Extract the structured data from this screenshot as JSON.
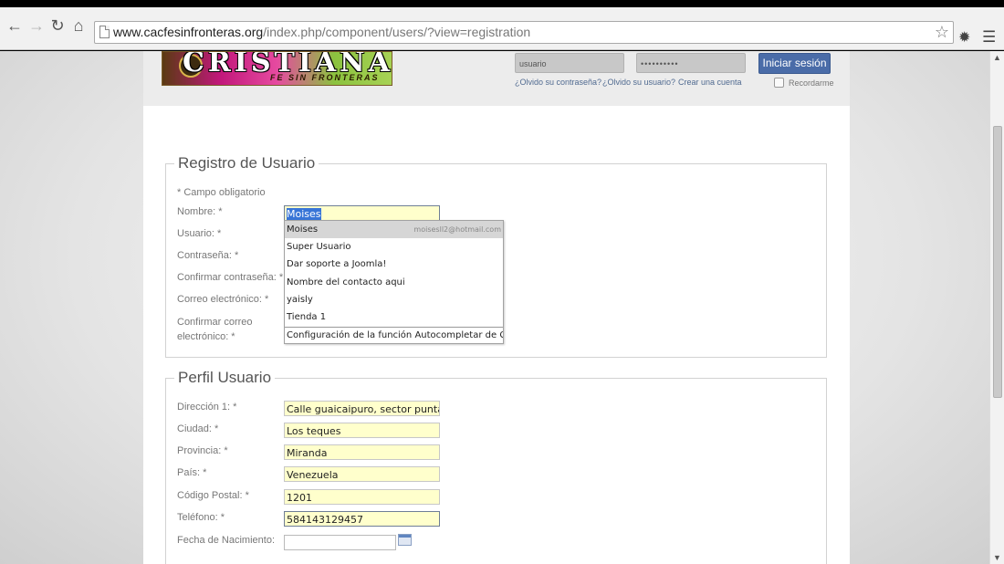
{
  "browser": {
    "url_host": "www.cacfesinfronteras.org",
    "url_path": "/index.php/component/users/?view=registration"
  },
  "header": {
    "logo_title": "CRISTIANA",
    "logo_subtitle": "FE SIN FRONTERAS",
    "login": {
      "username_placeholder": "usuario",
      "password_value": "••••••••••",
      "submit_label": "Iniciar sesión",
      "forgot_password": "¿Olvido su contraseña?",
      "forgot_username": "¿Olvido su usuario?",
      "create_account": "Crear una cuenta",
      "remember_label": "Recordarme"
    }
  },
  "registration": {
    "legend": "Registro de Usuario",
    "required_note": "* Campo obligatorio",
    "fields": {
      "name_label": "Nombre: *",
      "name_value": "Moises",
      "username_label": "Usuario: *",
      "password_label": "Contraseña: *",
      "confirm_password_label": "Confirmar contraseña: *",
      "email_label": "Correo electrónico: *",
      "confirm_email_label_1": "Confirmar correo",
      "confirm_email_label_2": "electrónico: *"
    }
  },
  "autocomplete": {
    "items": [
      {
        "label": "Moises",
        "hint": "moisesll2@hotmail.com"
      },
      {
        "label": "Super Usuario"
      },
      {
        "label": "Dar soporte a Joomla!"
      },
      {
        "label": "Nombre del contacto aqui"
      },
      {
        "label": "yaisly"
      },
      {
        "label": "Tienda 1"
      }
    ],
    "footer": "Configuración de la función Autocompletar de Chrome..."
  },
  "profile": {
    "legend": "Perfil Usuario",
    "fields": [
      {
        "label": "Dirección 1: *",
        "value": "Calle guaicaipuro, sector punta brava"
      },
      {
        "label": "Ciudad: *",
        "value": "Los teques"
      },
      {
        "label": "Provincia: *",
        "value": "Miranda"
      },
      {
        "label": "País: *",
        "value": "Venezuela"
      },
      {
        "label": "Código Postal: *",
        "value": "1201"
      },
      {
        "label": "Teléfono: *",
        "value": "584143129457"
      },
      {
        "label": "Fecha de Nacimiento:",
        "value": ""
      }
    ]
  }
}
